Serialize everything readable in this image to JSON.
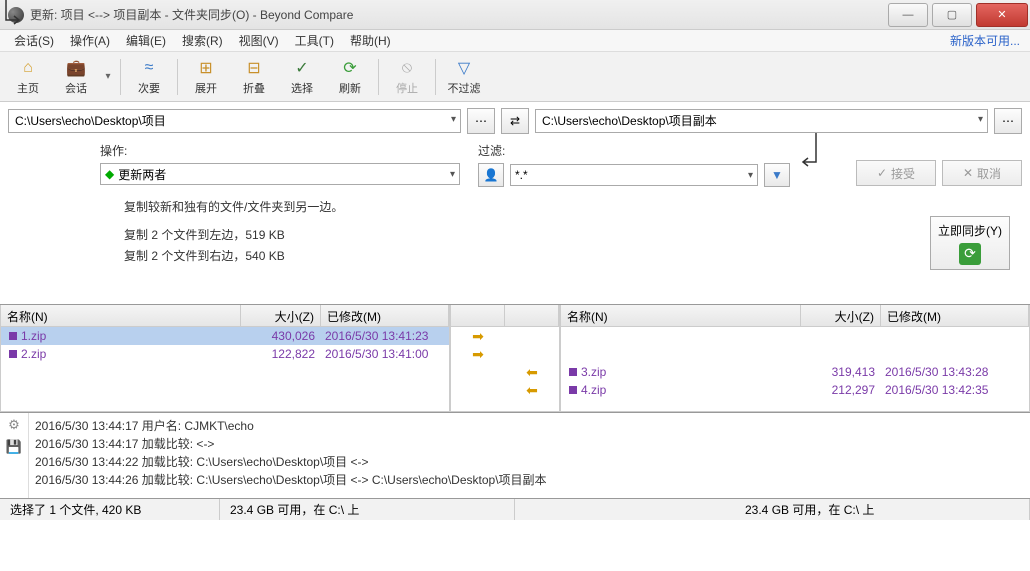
{
  "title": "更新: 项目 <--> 项目副本 - 文件夹同步(O) - Beyond Compare",
  "update_link": "新版本可用...",
  "menu": [
    "会话(S)",
    "操作(A)",
    "编辑(E)",
    "搜索(R)",
    "视图(V)",
    "工具(T)",
    "帮助(H)"
  ],
  "toolbar": {
    "home": "主页",
    "session": "会话",
    "next": "次要",
    "expand": "展开",
    "collapse": "折叠",
    "select": "选择",
    "refresh": "刷新",
    "stop": "停止",
    "nofilter": "不过滤"
  },
  "paths": {
    "left": "C:\\Users\\echo\\Desktop\\项目",
    "right": "C:\\Users\\echo\\Desktop\\项目副本"
  },
  "op": {
    "label": "操作:",
    "value": "更新两者"
  },
  "filter": {
    "label": "过滤:",
    "value": "*.*"
  },
  "buttons": {
    "accept": "接受",
    "cancel": "取消",
    "sync": "立即同步(Y)"
  },
  "desc": {
    "d1": "复制较新和独有的文件/文件夹到另一边。",
    "d2": "复制 2 个文件到左边，519 KB",
    "d3": "复制 2 个文件到右边，540 KB"
  },
  "headers": {
    "name": "名称(N)",
    "size": "大小(Z)",
    "date": "已修改(M)"
  },
  "leftFiles": [
    {
      "name": "1.zip",
      "size": "430,026",
      "date": "2016/5/30 13:41:23",
      "selected": true
    },
    {
      "name": "2.zip",
      "size": "122,822",
      "date": "2016/5/30 13:41:00",
      "selected": false
    }
  ],
  "rightFiles": [
    {
      "name": "3.zip",
      "size": "319,413",
      "date": "2016/5/30 13:43:28"
    },
    {
      "name": "4.zip",
      "size": "212,297",
      "date": "2016/5/30 13:42:35"
    }
  ],
  "log": [
    "2016/5/30 13:44:17  用户名: CJMKT\\echo",
    "2016/5/30 13:44:17  加载比较: <->",
    "2016/5/30 13:44:22  加载比较: C:\\Users\\echo\\Desktop\\项目 <->",
    "2016/5/30 13:44:26  加载比较: C:\\Users\\echo\\Desktop\\项目 <-> C:\\Users\\echo\\Desktop\\项目副本"
  ],
  "status": {
    "sel": "选择了 1 个文件, 420 KB",
    "left": "23.4 GB 可用，在 C:\\ 上",
    "right": "23.4 GB 可用，在 C:\\ 上"
  }
}
